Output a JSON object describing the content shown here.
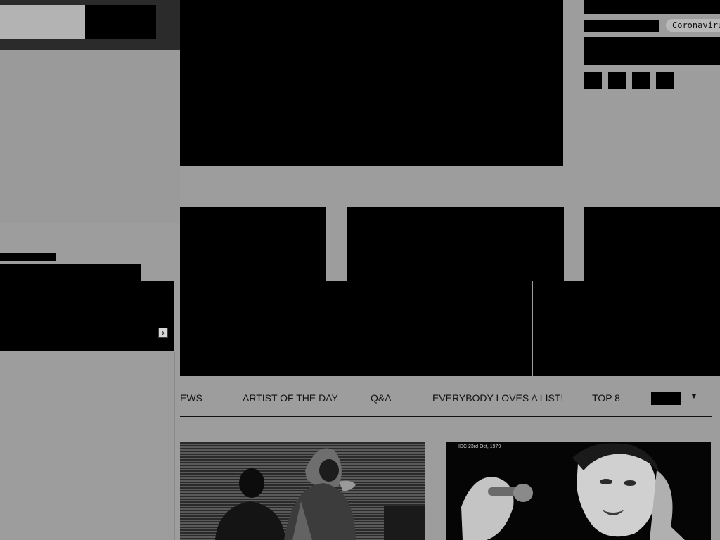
{
  "header": {
    "search_placeholder": "",
    "search_button_label": ""
  },
  "right_panel": {
    "tag_label": "Coronavirus"
  },
  "left_panel": {
    "next_icon": "chevron-right-icon"
  },
  "nav": {
    "items": [
      {
        "label": "EWS"
      },
      {
        "label": "ARTIST OF THE DAY"
      },
      {
        "label": "Q&A"
      },
      {
        "label": "EVERYBODY LOVES A LIST!"
      },
      {
        "label": "TOP 8"
      }
    ],
    "more_icon": "caret-down-icon",
    "more_glyph": "▼"
  },
  "articles": [
    {
      "image": "duo-performing-on-stage-photo"
    },
    {
      "image": "singer-with-microphone-photo",
      "caption": "IDC 23rd Oct, 1979"
    }
  ],
  "icons": {
    "social": [
      "social-icon-1",
      "social-icon-2",
      "social-icon-3",
      "social-icon-4"
    ]
  },
  "colors": {
    "page_background": "#9d9d9d",
    "dark_bar": "#2b2b2b",
    "redacted": "#000000",
    "tag_background": "#b9b9b9"
  }
}
